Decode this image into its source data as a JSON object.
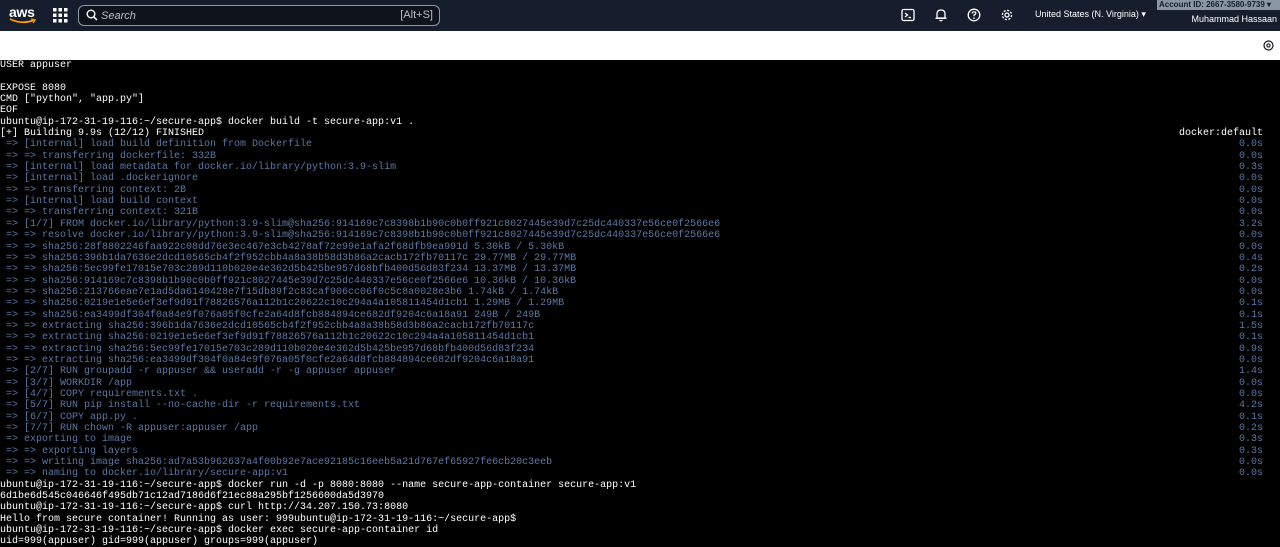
{
  "header": {
    "logo_text": "aws",
    "search_placeholder": "Search",
    "search_shortcut": "[Alt+S]",
    "region": "United States (N. Virginia) ▾",
    "account_id": "Account ID: 2667-3580-9739 ▾",
    "user_name": "Muhammad Hassaan"
  },
  "colors": {
    "topbar": "#161e2d",
    "terminal_bg": "#000000",
    "terminal_text": "#ffffff",
    "terminal_dim": "#5a78a6"
  },
  "terminal": {
    "lines": [
      {
        "text": "USER appuser",
        "dim": false,
        "right": ""
      },
      {
        "text": "",
        "dim": false,
        "right": ""
      },
      {
        "text": "EXPOSE 8080",
        "dim": false,
        "right": ""
      },
      {
        "text": "CMD [\"python\", \"app.py\"]",
        "dim": false,
        "right": ""
      },
      {
        "text": "EOF",
        "dim": false,
        "right": ""
      },
      {
        "text": "ubuntu@ip-172-31-19-116:~/secure-app$ docker build -t secure-app:v1 .",
        "dim": false,
        "right": ""
      },
      {
        "text": "[+] Building 9.9s (12/12) FINISHED",
        "dim": false,
        "right": "docker:default",
        "right_white": true
      },
      {
        "text": " => [internal] load build definition from Dockerfile",
        "dim": true,
        "right": "0.0s"
      },
      {
        "text": " => => transferring dockerfile: 332B",
        "dim": true,
        "right": "0.0s"
      },
      {
        "text": " => [internal] load metadata for docker.io/library/python:3.9-slim",
        "dim": true,
        "right": "0.3s"
      },
      {
        "text": " => [internal] load .dockerignore",
        "dim": true,
        "right": "0.0s"
      },
      {
        "text": " => => transferring context: 2B",
        "dim": true,
        "right": "0.0s"
      },
      {
        "text": " => [internal] load build context",
        "dim": true,
        "right": "0.0s"
      },
      {
        "text": " => => transferring context: 321B",
        "dim": true,
        "right": "0.0s"
      },
      {
        "text": " => [1/7] FROM docker.io/library/python:3.9-slim@sha256:914169c7c8398b1b90c0b0ff921c8027445e39d7c25dc440337e56ce0f2566e6",
        "dim": true,
        "right": "3.2s"
      },
      {
        "text": " => => resolve docker.io/library/python:3.9-slim@sha256:914169c7c8398b1b90c0b0ff921c8027445e39d7c25dc440337e56ce0f2566e6",
        "dim": true,
        "right": "0.0s"
      },
      {
        "text": " => => sha256:28f8802246faa922c08dd76e3ec467e3cb4278af72e99e1afa2f68dfb9ea991d 5.30kB / 5.30kB",
        "dim": true,
        "right": "0.0s"
      },
      {
        "text": " => => sha256:396b1da7636e2dcd10565cb4f2f952cbb4a8a38b58d3b86a2cacb172fb70117c 29.77MB / 29.77MB",
        "dim": true,
        "right": "0.4s"
      },
      {
        "text": " => => sha256:5ec99fe17015e703c289d110b020e4e362d5b425be957d68bfb400d56d83f234 13.37MB / 13.37MB",
        "dim": true,
        "right": "0.2s"
      },
      {
        "text": " => => sha256:914169c7c8398b1b90c0b0ff921c8027445e39d7c25dc440337e56ce0f2566e6 10.36kB / 10.36kB",
        "dim": true,
        "right": "0.0s"
      },
      {
        "text": " => => sha256:213766eae7e1ad5da6140428e7f15db89f2c83caf906cc06f0c5c8a0028e3b6 1.74kB / 1.74kB",
        "dim": true,
        "right": "0.0s"
      },
      {
        "text": " => => sha256:0219e1e5e6ef3ef9d91f78826576a112b1c20622c10c294a4a105811454d1cb1 1.29MB / 1.29MB",
        "dim": true,
        "right": "0.1s"
      },
      {
        "text": " => => sha256:ea3499df304f0a84e9f076a05f0cfe2a64d8fcb884894ce682df9204c6a18a91 249B / 249B",
        "dim": true,
        "right": "0.1s"
      },
      {
        "text": " => => extracting sha256:396b1da7636e2dcd10565cb4f2f952cbb4a8a38b58d3b86a2cacb172fb70117c",
        "dim": true,
        "right": "1.5s"
      },
      {
        "text": " => => extracting sha256:0219e1e5e6ef3ef9d91f78826576a112b1c20622c10c294a4a105811454d1cb1",
        "dim": true,
        "right": "0.1s"
      },
      {
        "text": " => => extracting sha256:5ec99fe17015e703c289d110b020e4e362d5b425be957d68bfb400d56d83f234",
        "dim": true,
        "right": "0.9s"
      },
      {
        "text": " => => extracting sha256:ea3499df304f0a84e9f076a05f0cfe2a64d8fcb884894ce682df9204c6a18a91",
        "dim": true,
        "right": "0.0s"
      },
      {
        "text": " => [2/7] RUN groupadd -r appuser && useradd -r -g appuser appuser",
        "dim": true,
        "right": "1.4s"
      },
      {
        "text": " => [3/7] WORKDIR /app",
        "dim": true,
        "right": "0.0s"
      },
      {
        "text": " => [4/7] COPY requirements.txt .",
        "dim": true,
        "right": "0.0s"
      },
      {
        "text": " => [5/7] RUN pip install --no-cache-dir -r requirements.txt",
        "dim": true,
        "right": "4.2s"
      },
      {
        "text": " => [6/7] COPY app.py .",
        "dim": true,
        "right": "0.1s"
      },
      {
        "text": " => [7/7] RUN chown -R appuser:appuser /app",
        "dim": true,
        "right": "0.2s"
      },
      {
        "text": " => exporting to image",
        "dim": true,
        "right": "0.3s"
      },
      {
        "text": " => => exporting layers",
        "dim": true,
        "right": "0.3s"
      },
      {
        "text": " => => writing image sha256:ad7a53b962637a4f00b92e7ace92185c16eeb5a21d767ef65927fe6cb20c3eeb",
        "dim": true,
        "right": "0.0s"
      },
      {
        "text": " => => naming to docker.io/library/secure-app:v1",
        "dim": true,
        "right": "0.0s"
      },
      {
        "text": "ubuntu@ip-172-31-19-116:~/secure-app$ docker run -d -p 8080:8080 --name secure-app-container secure-app:v1",
        "dim": false,
        "right": ""
      },
      {
        "text": "6d1be6d545c046646f495db71c12ad7186d6f21ec88a295bf1256600da5d3970",
        "dim": false,
        "right": ""
      },
      {
        "text": "ubuntu@ip-172-31-19-116:~/secure-app$ curl http://34.207.150.73:8080",
        "dim": false,
        "right": ""
      },
      {
        "text": "Hello from secure container! Running as user: 999ubuntu@ip-172-31-19-116:~/secure-app$",
        "dim": false,
        "right": ""
      },
      {
        "text": "ubuntu@ip-172-31-19-116:~/secure-app$ docker exec secure-app-container id",
        "dim": false,
        "right": ""
      },
      {
        "text": "uid=999(appuser) gid=999(appuser) groups=999(appuser)",
        "dim": false,
        "right": ""
      }
    ]
  }
}
